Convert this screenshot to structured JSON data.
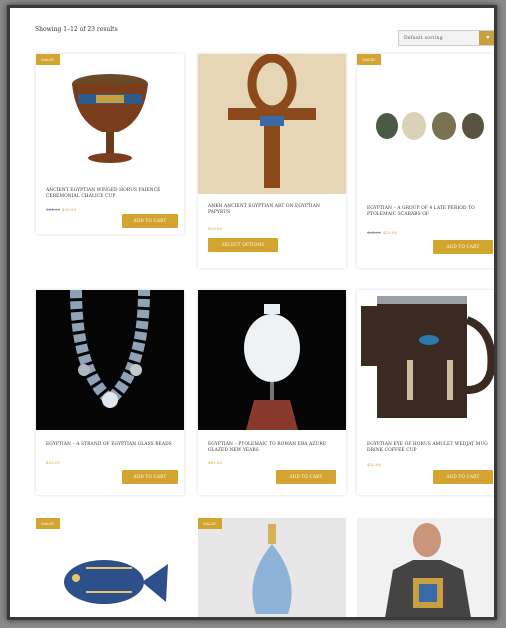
{
  "results_text": "Showing 1–12 of 23 results",
  "sort": {
    "selected": "Default sorting",
    "arrow": "▾"
  },
  "products": [
    {
      "title": "Ancient Egyptian Winged Horus Faience Ceremonial Chalice Cup",
      "old_price": "$44.99",
      "price": "$39.99",
      "sale": "SALE!",
      "button": "ADD TO CART"
    },
    {
      "title": "Ankh Ancient Egyptian Art on Egyptian Papyrus",
      "price": "$20.00",
      "button": "SELECT OPTIONS"
    },
    {
      "title": "Egyptian – A Group of 4 Late Period to Ptolemaic Scarabs of",
      "old_price": "$34.00",
      "price": "$29.00",
      "sale": "SALE!",
      "button": "ADD TO CART"
    },
    {
      "title": "Egyptian – A Strand of Egyptian Glass Beads",
      "price": "$55.00",
      "button": "ADD TO CART"
    },
    {
      "title": "Egyptian – Ptolemaic to Roman Era Azure Glazed New Years",
      "price": "$65.00",
      "button": "ADD TO CART"
    },
    {
      "title": "Egyptian Eye of Horus Amulet Wedjat Mug Drink Coffee Cup",
      "price": "$30.00",
      "button": "ADD TO CART"
    },
    {
      "sale": "SALE!"
    },
    {
      "sale": "SALE!"
    },
    {}
  ],
  "colors": {
    "accent": "#d4a431",
    "frame": "#3a3a3a"
  }
}
